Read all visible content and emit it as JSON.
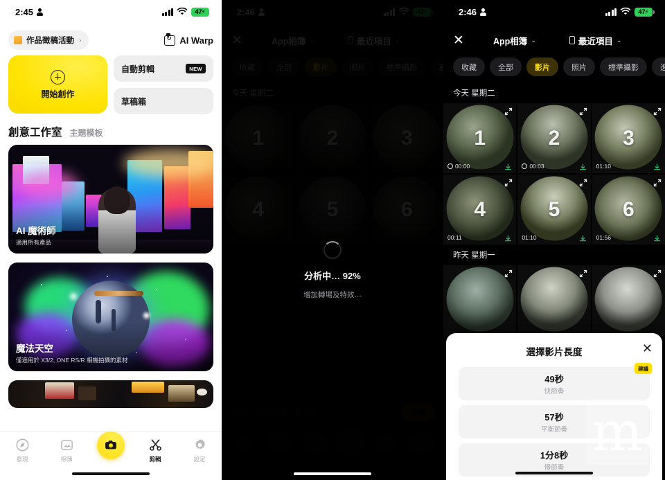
{
  "panels": {
    "home": {
      "status": {
        "time": "2:45",
        "battery": "47",
        "battery_color": "#30d158"
      },
      "promo_pill": {
        "label": "作品徵稿活動",
        "chevron": "›"
      },
      "ai_warp": {
        "label": "AI Warp"
      },
      "create_card": {
        "label": "開始創作"
      },
      "side_cards": [
        {
          "label": "自動剪輯",
          "badge": "NEW"
        },
        {
          "label": "草稿箱",
          "badge": ""
        }
      ],
      "section": {
        "title": "創意工作室",
        "subtitle": "主題模板"
      },
      "templates": [
        {
          "title": "AI 魔術師",
          "subtitle": "適用所有產品"
        },
        {
          "title": "魔法天空",
          "subtitle": "僅適用於 X3/2, ONE RS/R 相機拍攝的素材"
        },
        {
          "title": "",
          "subtitle": ""
        }
      ],
      "tabs": [
        {
          "label": "發現",
          "icon": "compass-icon",
          "active": false
        },
        {
          "label": "相薄",
          "icon": "album-icon",
          "active": false
        },
        {
          "label": "",
          "icon": "camera-icon",
          "active": false
        },
        {
          "label": "剪輯",
          "icon": "scissors-icon",
          "active": true
        },
        {
          "label": "設定",
          "icon": "gear-icon",
          "active": false
        }
      ]
    },
    "processing": {
      "status": {
        "time": "2:46",
        "battery": "47",
        "battery_color": "#30d158"
      },
      "close": "✕",
      "album_selector": {
        "label": "App相簿",
        "chevron": "⌄"
      },
      "recent_selector": {
        "label": "最近項目",
        "chevron": "⌄"
      },
      "chips": [
        "收藏",
        "全部",
        "影片",
        "照片",
        "標準攝影",
        "進階"
      ],
      "chip_selected": "影片",
      "overlay": {
        "title": "分析中… 92%",
        "subtitle": "增加轉場及特效…",
        "percent": 92
      },
      "bottom": {
        "selection_text": "已選取的項目將被分析處理",
        "continue_label": "繼續"
      }
    },
    "gallery": {
      "status": {
        "time": "2:46",
        "battery": "47",
        "battery_color": "#30d158"
      },
      "close": "✕",
      "album_selector": {
        "label": "App相簿",
        "chevron": "⌄"
      },
      "recent_selector": {
        "label": "最近項目",
        "chevron": "⌄"
      },
      "chips": [
        "收藏",
        "全部",
        "影片",
        "照片",
        "標準攝影",
        "進階"
      ],
      "chip_selected": "影片",
      "sections": [
        {
          "day_label": "今天 星期二",
          "items": [
            {
              "number": "1",
              "duration": "00:00"
            },
            {
              "number": "2",
              "duration": "00:03"
            },
            {
              "number": "3",
              "duration": "01:10"
            },
            {
              "number": "4",
              "duration": "00:11"
            },
            {
              "number": "5",
              "duration": "01:10"
            },
            {
              "number": "6",
              "duration": "01:56"
            }
          ]
        },
        {
          "day_label": "昨天 星期一",
          "items": [
            {
              "number": "",
              "duration": ""
            },
            {
              "number": "",
              "duration": ""
            },
            {
              "number": "",
              "duration": ""
            }
          ]
        }
      ],
      "sheet": {
        "title": "選擇影片長度",
        "close": "✕",
        "options": [
          {
            "duration": "49秒",
            "tempo": "快節奏",
            "badge": "建議"
          },
          {
            "duration": "57秒",
            "tempo": "平衡節奏",
            "badge": ""
          },
          {
            "duration": "1分8秒",
            "tempo": "慢節奏",
            "badge": ""
          }
        ]
      }
    }
  },
  "watermark": {
    "text": "m"
  }
}
